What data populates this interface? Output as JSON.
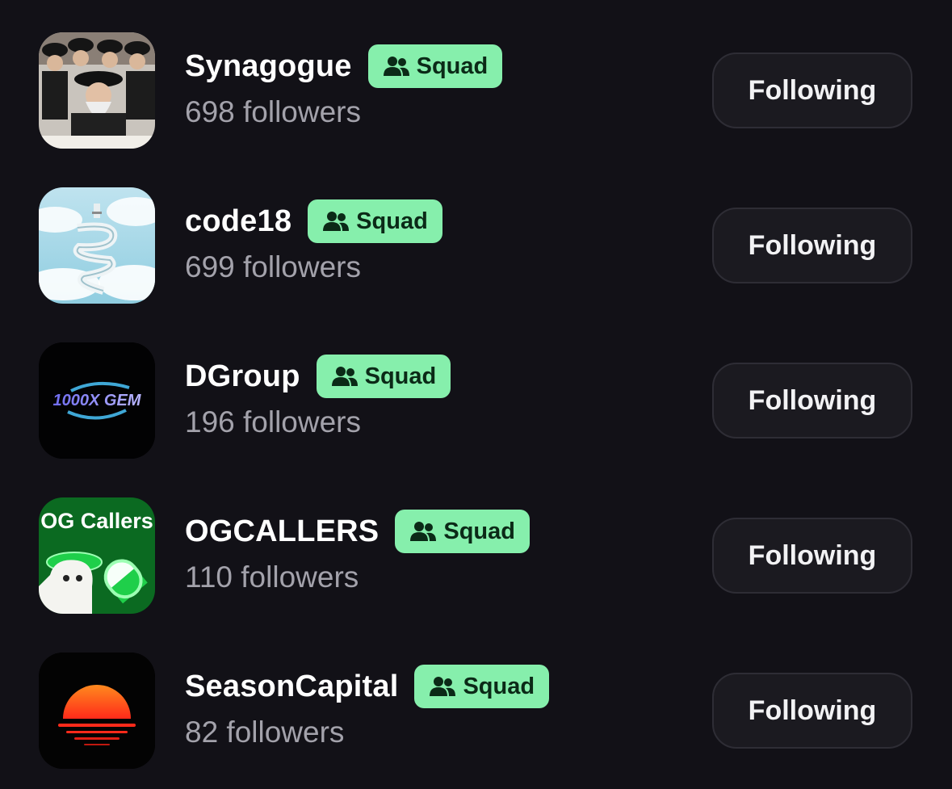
{
  "items": [
    {
      "name": "Synagogue",
      "badge": "Squad",
      "followers": "698 followers",
      "button": "Following",
      "avatar_icon": "synagogue-avatar"
    },
    {
      "name": "code18",
      "badge": "Squad",
      "followers": "699 followers",
      "button": "Following",
      "avatar_icon": "code18-avatar"
    },
    {
      "name": "DGroup",
      "badge": "Squad",
      "followers": "196 followers",
      "button": "Following",
      "avatar_icon": "dgroup-avatar",
      "avatar_text": "1000X GEM"
    },
    {
      "name": "OGCALLERS",
      "badge": "Squad",
      "followers": "110 followers",
      "button": "Following",
      "avatar_icon": "ogcallers-avatar",
      "avatar_text": "OG Callers"
    },
    {
      "name": "SeasonCapital",
      "badge": "Squad",
      "followers": "82 followers",
      "button": "Following",
      "avatar_icon": "seasoncapital-avatar"
    }
  ],
  "colors": {
    "background": "#121117",
    "badge_bg": "#86efac",
    "badge_text": "#0b2a17",
    "name_text": "#ffffff",
    "followers_text": "#a3a2ab",
    "button_bg": "#1b1a20",
    "button_border": "#2e2d35"
  }
}
